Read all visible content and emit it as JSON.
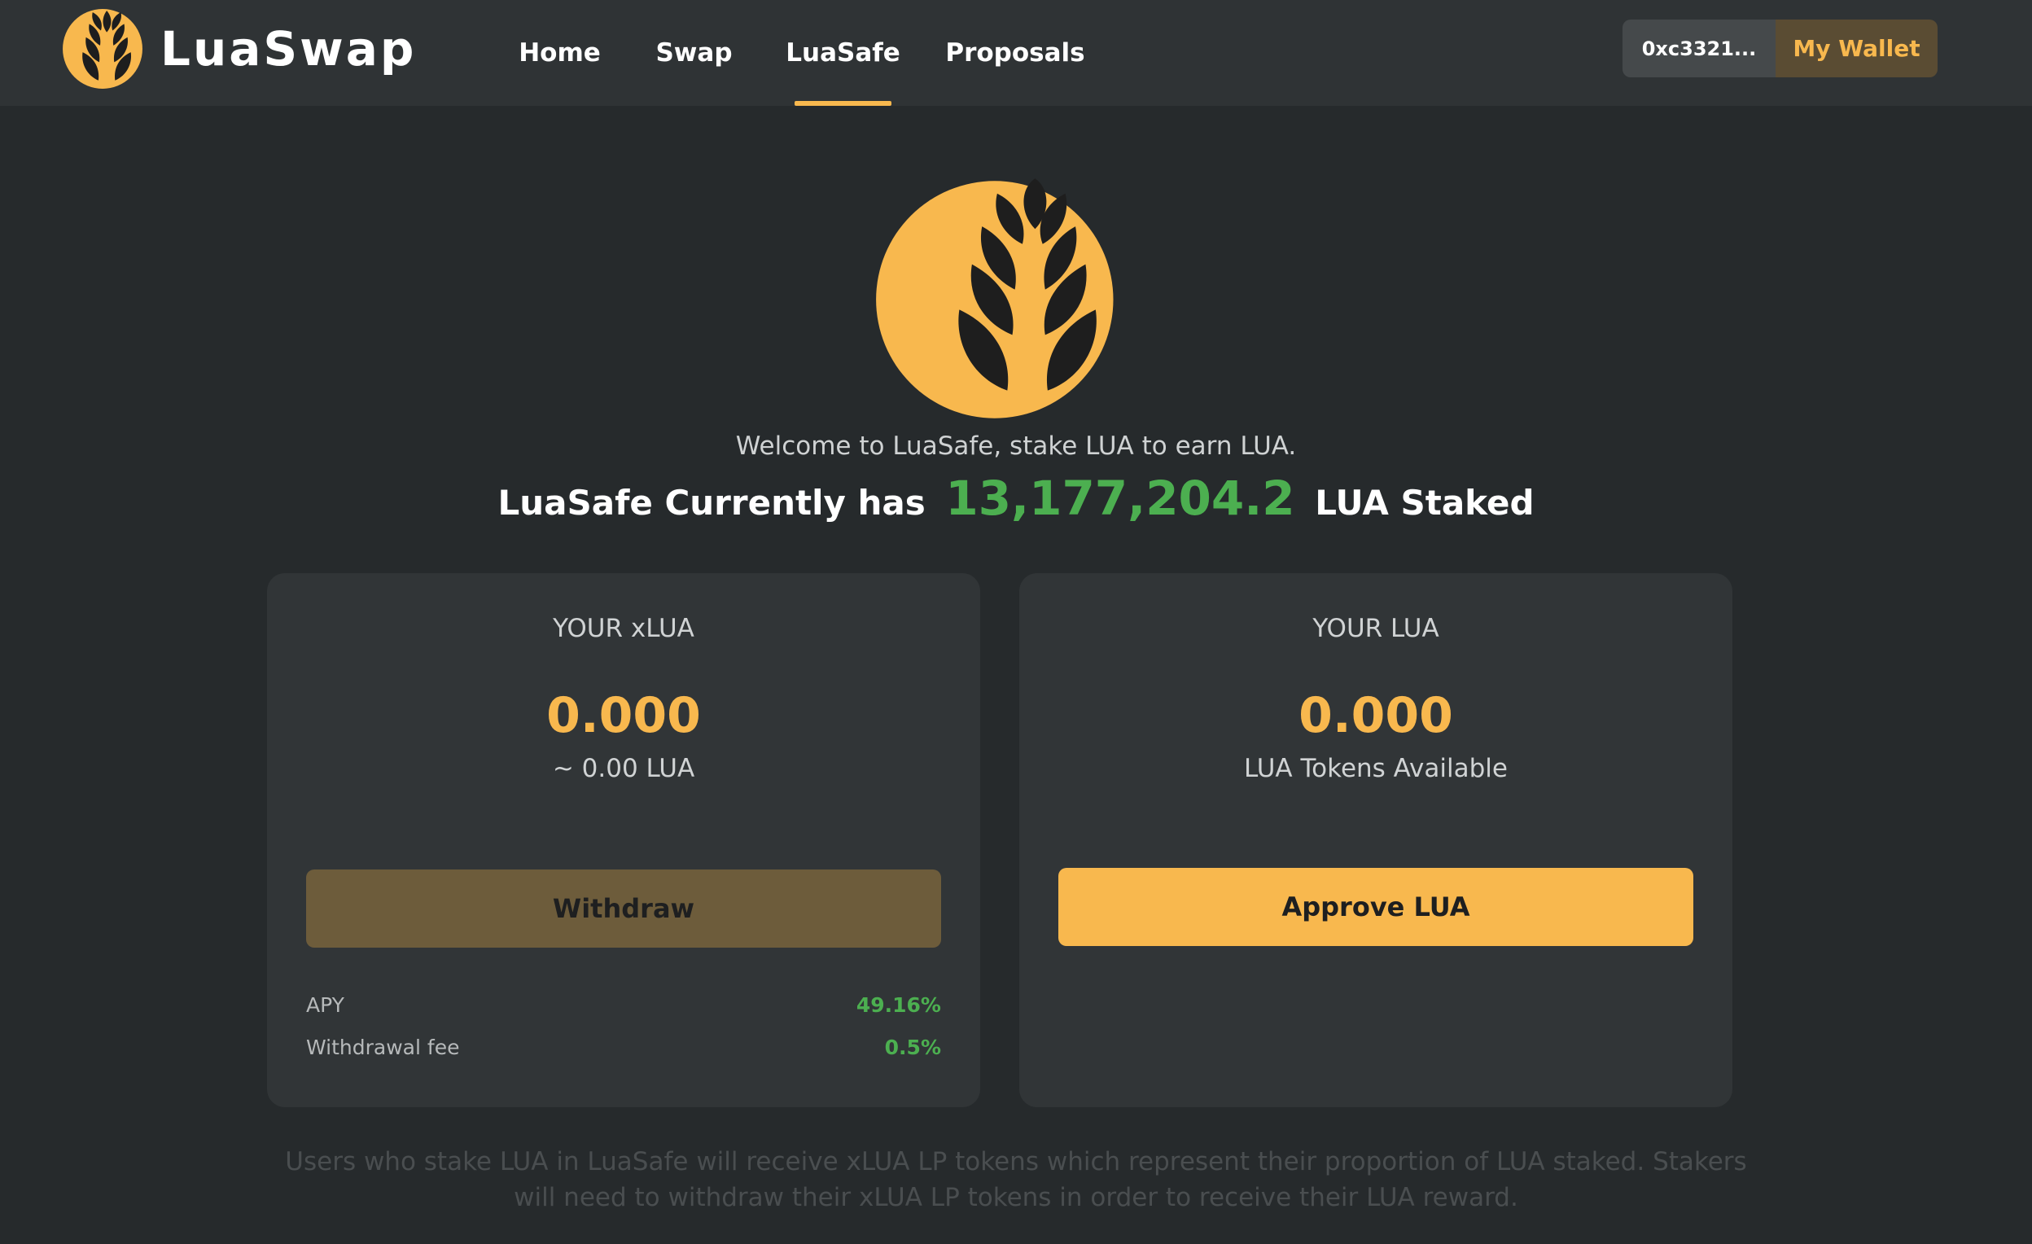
{
  "header": {
    "brand_name": "LuaSwap",
    "nav": [
      {
        "label": "Home",
        "active": false
      },
      {
        "label": "Swap",
        "active": false
      },
      {
        "label": "LuaSafe",
        "active": true
      },
      {
        "label": "Proposals",
        "active": false
      }
    ],
    "wallet_address": "0xc3321...",
    "wallet_button": "My Wallet"
  },
  "hero": {
    "welcome": "Welcome to LuaSafe, stake LUA to earn LUA.",
    "staked_prefix": "LuaSafe Currently has",
    "staked_amount": "13,177,204.2",
    "staked_suffix": "LUA Staked"
  },
  "xlua_card": {
    "label": "YOUR xLUA",
    "value": "0.000",
    "sub": "~ 0.00 LUA",
    "button": "Withdraw",
    "stats": [
      {
        "key": "APY",
        "value": "49.16%"
      },
      {
        "key": "Withdrawal fee",
        "value": "0.5%"
      }
    ]
  },
  "lua_card": {
    "label": "YOUR LUA",
    "value": "0.000",
    "sub": "LUA Tokens Available",
    "button": "Approve LUA"
  },
  "footnote": "Users who stake LUA in LuaSafe will receive xLUA LP tokens which represent their proportion of LUA staked. Stakers will need to withdraw their xLUA LP tokens in order to receive their LUA reward.",
  "colors": {
    "accent": "#f8b84e",
    "positive": "#4caf50",
    "background": "#262a2c",
    "card": "#313537"
  },
  "icons": [
    "luaswap-wheat-logo"
  ]
}
